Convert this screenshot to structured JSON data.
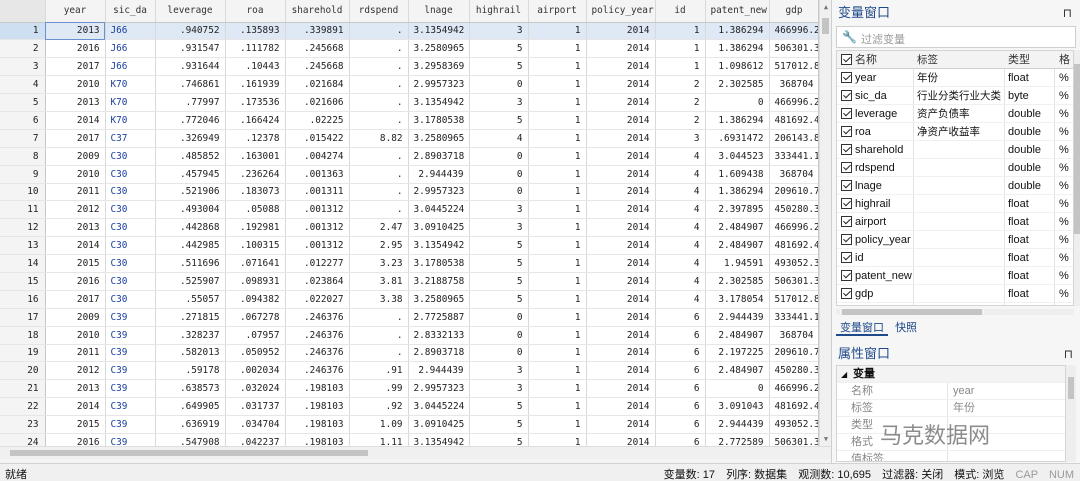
{
  "grid": {
    "columns": [
      "year",
      "sic_da",
      "leverage",
      "roa",
      "sharehold",
      "rdspend",
      "lnage",
      "highrail",
      "airport",
      "policy_year",
      "id",
      "patent_new",
      "gdp"
    ],
    "rows": [
      [
        "1",
        "2013",
        "J66",
        ".940752",
        ".135893",
        ".339891",
        ".",
        "3.1354942",
        "3",
        "1",
        "2014",
        "1",
        "1.386294",
        "466996.2"
      ],
      [
        "2",
        "2016",
        "J66",
        ".931547",
        ".111782",
        ".245668",
        ".",
        "3.2580965",
        "5",
        "1",
        "2014",
        "1",
        "1.386294",
        "506301.3"
      ],
      [
        "3",
        "2017",
        "J66",
        ".931644",
        ".10443",
        ".245668",
        ".",
        "3.2958369",
        "5",
        "1",
        "2014",
        "1",
        "1.098612",
        "517012.8"
      ],
      [
        "4",
        "2010",
        "K70",
        ".746861",
        ".161939",
        ".021684",
        ".",
        "2.9957323",
        "0",
        "1",
        "2014",
        "2",
        "2.302585",
        "368704"
      ],
      [
        "5",
        "2013",
        "K70",
        ".77997",
        ".173536",
        ".021606",
        ".",
        "3.1354942",
        "3",
        "1",
        "2014",
        "2",
        "0",
        "466996.2"
      ],
      [
        "6",
        "2014",
        "K70",
        ".772046",
        ".166424",
        ".02225",
        ".",
        "3.1780538",
        "5",
        "1",
        "2014",
        "2",
        "1.386294",
        "481692.4"
      ],
      [
        "7",
        "2017",
        "C37",
        ".326949",
        ".12378",
        ".015422",
        "8.82",
        "3.2580965",
        "4",
        "1",
        "2014",
        "3",
        ".6931472",
        "206143.8"
      ],
      [
        "8",
        "2009",
        "C30",
        ".485852",
        ".163001",
        ".004274",
        ".",
        "2.8903718",
        "0",
        "1",
        "2014",
        "4",
        "3.044523",
        "333441.1"
      ],
      [
        "9",
        "2010",
        "C30",
        ".457945",
        ".236264",
        ".001363",
        ".",
        "2.944439",
        "0",
        "1",
        "2014",
        "4",
        "1.609438",
        "368704"
      ],
      [
        "10",
        "2011",
        "C30",
        ".521906",
        ".183073",
        ".001311",
        ".",
        "2.9957323",
        "0",
        "1",
        "2014",
        "4",
        "1.386294",
        "209610.7"
      ],
      [
        "11",
        "2012",
        "C30",
        ".493004",
        ".05088",
        ".001312",
        ".",
        "3.0445224",
        "3",
        "1",
        "2014",
        "4",
        "2.397895",
        "450280.3"
      ],
      [
        "12",
        "2013",
        "C30",
        ".442868",
        ".192981",
        ".001312",
        "2.47",
        "3.0910425",
        "3",
        "1",
        "2014",
        "4",
        "2.484907",
        "466996.2"
      ],
      [
        "13",
        "2014",
        "C30",
        ".442985",
        ".100315",
        ".001312",
        "2.95",
        "3.1354942",
        "5",
        "1",
        "2014",
        "4",
        "2.484907",
        "481692.4"
      ],
      [
        "14",
        "2015",
        "C30",
        ".511696",
        ".071641",
        ".012277",
        "3.23",
        "3.1780538",
        "5",
        "1",
        "2014",
        "4",
        "1.94591",
        "493052.3"
      ],
      [
        "15",
        "2016",
        "C30",
        ".525907",
        ".098931",
        ".023864",
        "3.81",
        "3.2188758",
        "5",
        "1",
        "2014",
        "4",
        "2.302585",
        "506301.3"
      ],
      [
        "16",
        "2017",
        "C30",
        ".55057",
        ".094382",
        ".022027",
        "3.38",
        "3.2580965",
        "5",
        "1",
        "2014",
        "4",
        "3.178054",
        "517012.8"
      ],
      [
        "17",
        "2009",
        "C39",
        ".271815",
        ".067278",
        ".246376",
        ".",
        "2.7725887",
        "0",
        "1",
        "2014",
        "6",
        "2.944439",
        "333441.1"
      ],
      [
        "18",
        "2010",
        "C39",
        ".328237",
        ".07957",
        ".246376",
        ".",
        "2.8332133",
        "0",
        "1",
        "2014",
        "6",
        "2.484907",
        "368704"
      ],
      [
        "19",
        "2011",
        "C39",
        ".582013",
        ".050952",
        ".246376",
        ".",
        "2.8903718",
        "0",
        "1",
        "2014",
        "6",
        "2.197225",
        "209610.7"
      ],
      [
        "20",
        "2012",
        "C39",
        ".59178",
        ".002034",
        ".246376",
        ".91",
        "2.944439",
        "3",
        "1",
        "2014",
        "6",
        "2.484907",
        "450280.3"
      ],
      [
        "21",
        "2013",
        "C39",
        ".638573",
        ".032024",
        ".198103",
        ".99",
        "2.9957323",
        "3",
        "1",
        "2014",
        "6",
        "0",
        "466996.2"
      ],
      [
        "22",
        "2014",
        "C39",
        ".649905",
        ".031737",
        ".198103",
        ".92",
        "3.0445224",
        "5",
        "1",
        "2014",
        "6",
        "3.091043",
        "481692.4"
      ],
      [
        "23",
        "2015",
        "C39",
        ".636919",
        ".034704",
        ".198103",
        "1.09",
        "3.0910425",
        "5",
        "1",
        "2014",
        "6",
        "2.944439",
        "493052.3"
      ],
      [
        "24",
        "2016",
        "C39",
        ".547908",
        ".042237",
        ".198103",
        "1.11",
        "3.1354942",
        "5",
        "1",
        "2014",
        "6",
        "2.772589",
        "506301.3"
      ]
    ]
  },
  "varpanel": {
    "title": "变量窗口",
    "pin": "⊓",
    "filter_placeholder": "过滤变量",
    "headers": {
      "name": "名称",
      "label": "标签",
      "type": "类型",
      "fmt": "格"
    },
    "vars": [
      {
        "name": "year",
        "label": "年份",
        "type": "float",
        "fmt": "%"
      },
      {
        "name": "sic_da",
        "label": "行业分类行业大类",
        "type": "byte",
        "fmt": "%"
      },
      {
        "name": "leverage",
        "label": "资产负债率",
        "type": "double",
        "fmt": "%"
      },
      {
        "name": "roa",
        "label": "净资产收益率",
        "type": "double",
        "fmt": "%"
      },
      {
        "name": "sharehold",
        "label": "",
        "type": "double",
        "fmt": "%"
      },
      {
        "name": "rdspend",
        "label": "",
        "type": "double",
        "fmt": "%"
      },
      {
        "name": "lnage",
        "label": "",
        "type": "double",
        "fmt": "%"
      },
      {
        "name": "highrail",
        "label": "",
        "type": "float",
        "fmt": "%"
      },
      {
        "name": "airport",
        "label": "",
        "type": "float",
        "fmt": "%"
      },
      {
        "name": "policy_year",
        "label": "",
        "type": "float",
        "fmt": "%"
      },
      {
        "name": "id",
        "label": "",
        "type": "float",
        "fmt": "%"
      },
      {
        "name": "patent_new",
        "label": "",
        "type": "float",
        "fmt": "%"
      },
      {
        "name": "gdp",
        "label": "",
        "type": "float",
        "fmt": "%"
      }
    ],
    "tabs": [
      "变量窗口",
      "快照"
    ]
  },
  "propspanel": {
    "title": "属性窗口",
    "pin": "⊓",
    "group": "变量",
    "rows": [
      {
        "k": "名称",
        "v": "year"
      },
      {
        "k": "标签",
        "v": "年份"
      },
      {
        "k": "类型",
        "v": ""
      },
      {
        "k": "格式",
        "v": ""
      },
      {
        "k": "值标签",
        "v": ""
      }
    ]
  },
  "watermark": "马克数据网",
  "status": {
    "left": "就绪",
    "vars": "变量数: 17",
    "order": "列序: 数据集",
    "obs": "观测数: 10,695",
    "filter": "过滤器: 关闭",
    "mode": "模式: 浏览",
    "cap": "CAP",
    "num": "NUM"
  }
}
